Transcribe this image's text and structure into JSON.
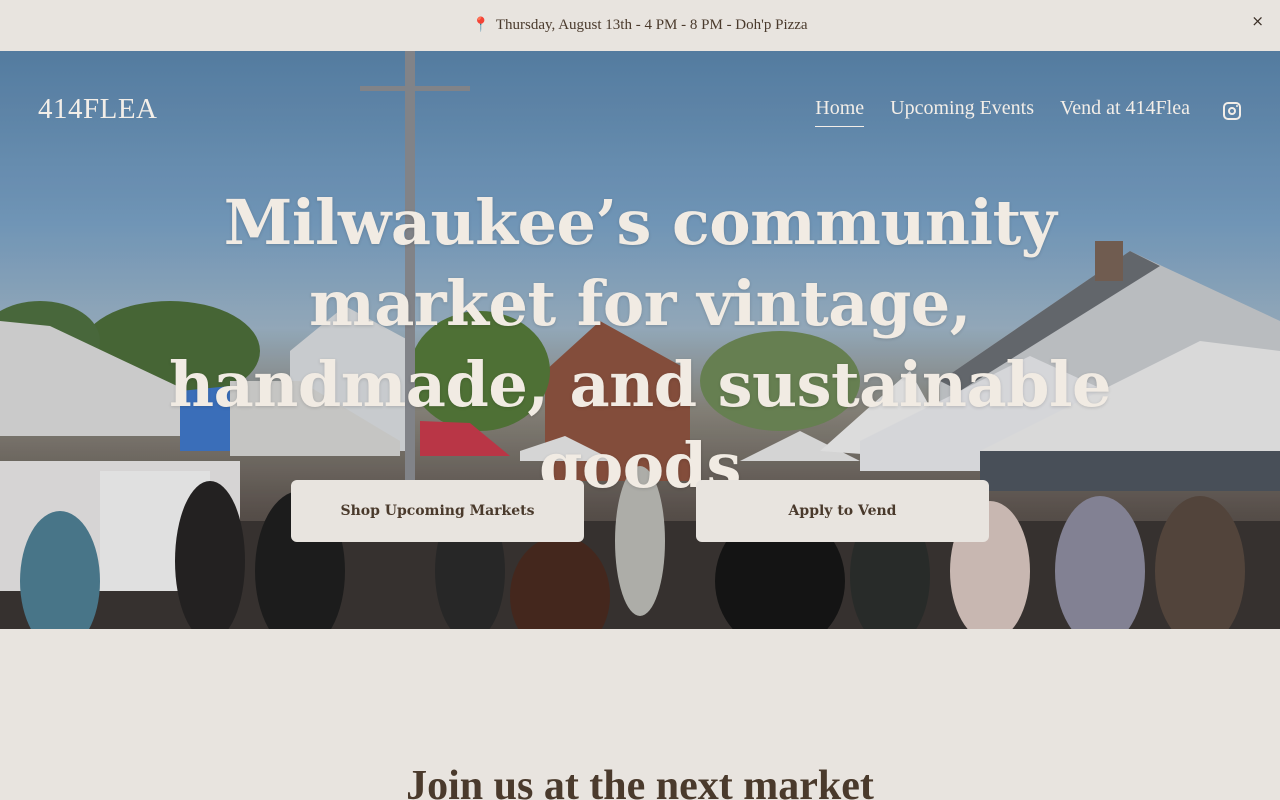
{
  "announcement": {
    "pin_icon": "📍",
    "text": "Thursday, August 13th - 4 PM - 8 PM -  Doh'p Pizza",
    "close_label": "×"
  },
  "header": {
    "logo": "414FLEA",
    "nav": [
      {
        "label": "Home",
        "active": true
      },
      {
        "label": "Upcoming Events",
        "active": false
      },
      {
        "label": "Vend at 414Flea",
        "active": false
      }
    ],
    "social_icon": "instagram-icon"
  },
  "hero": {
    "headline": "Milwaukee’s community market for vintage, handmade, and sustainable goods",
    "buttons": {
      "shop": "Shop Upcoming Markets",
      "vend": "Apply to Vend"
    }
  },
  "section": {
    "title": "Join us at the next market"
  },
  "colors": {
    "background": "#e8e4df",
    "text": "#4a3a2c",
    "hero_text": "#f1ebe3"
  }
}
